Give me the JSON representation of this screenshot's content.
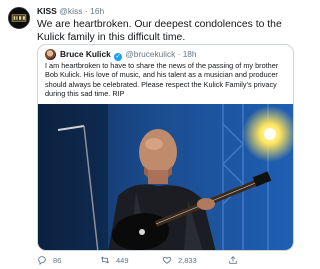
{
  "tweet": {
    "author_name": "KISS",
    "author_handle": "@kiss",
    "separator": "·",
    "timestamp": "16h",
    "text": "We are heartbroken. Our deepest condolences to the Kulick family in this difficult time."
  },
  "quoted": {
    "author_name": "Bruce Kulick",
    "verified_glyph": "✓",
    "author_handle": "@brucekulick",
    "separator": "·",
    "timestamp": "18h",
    "text": "I am heartbroken to have to share the news of the passing of my brother Bob Kulick. His love of music, and his talent as a musician and producer should always be celebrated. Please respect the Kulick Family's privacy during this sad time.  RIP"
  },
  "actions": {
    "reply_count": "86",
    "retweet_count": "449",
    "like_count": "2,833"
  },
  "icons": {
    "reply": "reply-icon",
    "retweet": "retweet-icon",
    "like": "heart-icon",
    "share": "share-icon",
    "verified": "verified-badge-icon"
  },
  "colors": {
    "text": "#14171a",
    "muted": "#657786",
    "border": "#ccd6dd",
    "verified": "#1da1f2",
    "stage_blue": "#1f5fb3",
    "stage_light": "#ffe55c"
  }
}
